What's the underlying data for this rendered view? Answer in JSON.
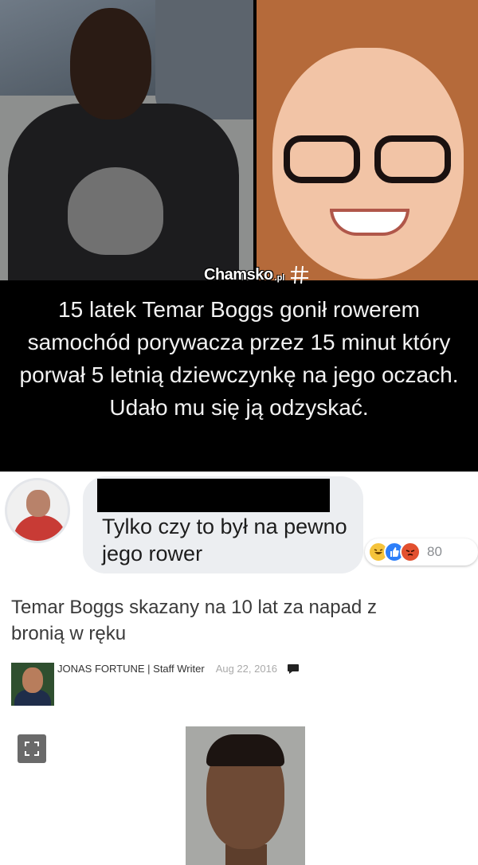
{
  "meme": {
    "caption": "15 latek Temar Boggs gonił rowerem samochód porywacza przez 15 minut który porwał 5 letnią dziewczynkę na jego oczach. Udało mu się ją odzyskać.",
    "watermark": {
      "brand": "Chamsko",
      "suffix": ".pl"
    }
  },
  "comment": {
    "text": "Tylko czy to był na pewno jego rower",
    "reactions": {
      "icons": [
        "haha-icon",
        "like-icon",
        "angry-icon"
      ],
      "count": "80"
    }
  },
  "article": {
    "headline": "Temar Boggs skazany na 10 lat za napad z bronią w ręku",
    "author": "JONAS FORTUNE | Staff Writer",
    "date": "Aug 22, 2016"
  },
  "colors": {
    "caption_bg": "#000000",
    "caption_text": "#f2f2f2",
    "bubble_bg": "#eceef1",
    "like_blue": "#2d7ff9",
    "haha_yellow": "#f5c33b",
    "angry_red": "#e2502f"
  }
}
